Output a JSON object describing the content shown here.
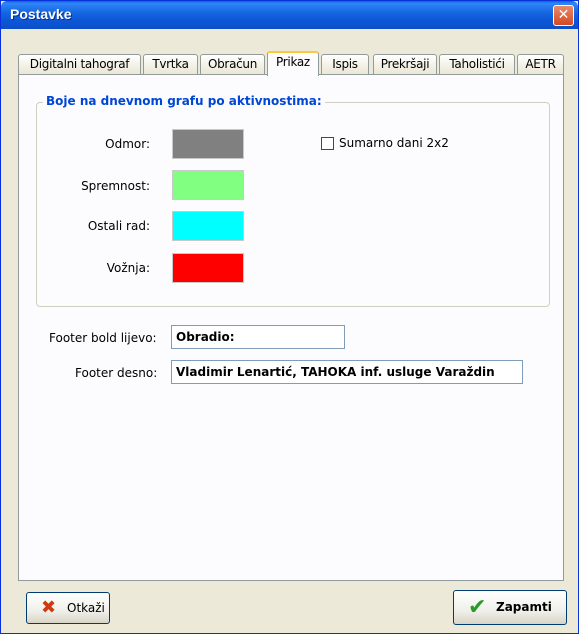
{
  "window": {
    "title": "Postavke"
  },
  "tabs": [
    {
      "label": "Digitalni tahograf"
    },
    {
      "label": "Tvrtka"
    },
    {
      "label": "Obračun"
    },
    {
      "label": "Prikaz"
    },
    {
      "label": "Ispis"
    },
    {
      "label": "Prekršaji"
    },
    {
      "label": "Taholistići"
    },
    {
      "label": "AETR"
    }
  ],
  "group": {
    "title": "Boje na dnevnom grafu po aktivnostima:",
    "colors": [
      {
        "label": "Odmor:",
        "color": "#808080"
      },
      {
        "label": "Spremnost:",
        "color": "#80ff80"
      },
      {
        "label": "Ostali rad:",
        "color": "#00ffff"
      },
      {
        "label": "Vožnja:",
        "color": "#ff0000"
      }
    ],
    "checkbox_label": "Sumarno dani 2x2"
  },
  "footer": {
    "left_label": "Footer bold lijevo:",
    "left_value": "Obradio:",
    "right_label": "Footer desno:",
    "right_value": "Vladimir Lenartić, TAHOKA inf. usluge Varaždin"
  },
  "buttons": {
    "cancel": "Otkaži",
    "save": "Zapamti"
  }
}
